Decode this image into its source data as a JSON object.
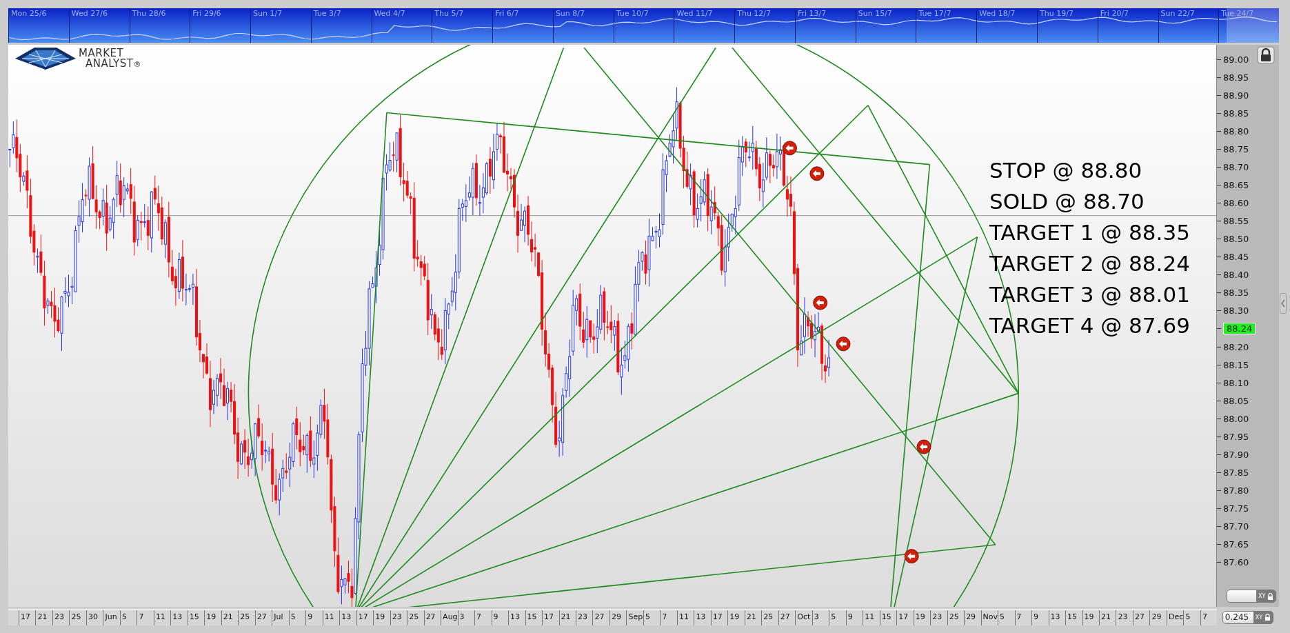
{
  "overview": {
    "labels": [
      "Mon 25/6",
      "Wed 27/6",
      "Thu 28/6",
      "Fri 29/6",
      "Sun 1/7",
      "Tue 3/7",
      "Wed 4/7",
      "Thu 5/7",
      "Fri 6/7",
      "Sun 8/7",
      "Tue 10/7",
      "Wed 11/7",
      "Thu 12/7",
      "Fri 13/7",
      "Sun 15/7",
      "Tue 17/7",
      "Wed 18/7",
      "Thu 19/7",
      "Fri 20/7",
      "Sun 22/7",
      "Tue 24/7"
    ]
  },
  "chart": {
    "logo": {
      "line1": "MARKET",
      "line2": "ANALYST",
      "mark": "®"
    },
    "notes": [
      "STOP @ 88.80",
      "SOLD @ 88.70",
      "TARGET 1 @ 88.35",
      "TARGET 2 @ 88.24",
      "TARGET 3 @ 88.01",
      "TARGET 4 @ 87.69"
    ],
    "price_axis": [
      {
        "text": "89.00",
        "kind": "tick"
      },
      {
        "text": "88.95",
        "kind": "tick"
      },
      {
        "text": "88.90",
        "kind": "tick"
      },
      {
        "text": "88.85",
        "kind": "tick"
      },
      {
        "text": "88.80",
        "kind": "tick"
      },
      {
        "text": "88.75",
        "kind": "tick"
      },
      {
        "text": "88.70",
        "kind": "tick"
      },
      {
        "text": "88.65",
        "kind": "tick"
      },
      {
        "text": "88.60",
        "kind": "tick"
      },
      {
        "text": "88.55",
        "kind": "tick"
      },
      {
        "text": "88.50",
        "kind": "tick"
      },
      {
        "text": "88.45",
        "kind": "tick"
      },
      {
        "text": "88.40",
        "kind": "tick"
      },
      {
        "text": "88.35",
        "kind": "tick"
      },
      {
        "text": "88.30",
        "kind": "tick"
      },
      {
        "text": "88.24",
        "kind": "current"
      },
      {
        "text": "88.20",
        "kind": "tick"
      },
      {
        "text": "88.15",
        "kind": "tick"
      },
      {
        "text": "88.10",
        "kind": "tick"
      },
      {
        "text": "88.05",
        "kind": "tick"
      },
      {
        "text": "88.00",
        "kind": "tick"
      },
      {
        "text": "87.95",
        "kind": "tick"
      },
      {
        "text": "87.90",
        "kind": "tick"
      },
      {
        "text": "87.85",
        "kind": "tick"
      },
      {
        "text": "87.80",
        "kind": "tick"
      },
      {
        "text": "87.75",
        "kind": "tick"
      },
      {
        "text": "87.70",
        "kind": "tick"
      },
      {
        "text": "87.65",
        "kind": "tick"
      },
      {
        "text": "87.60",
        "kind": "tick"
      }
    ]
  },
  "date_axis": [
    "17",
    "21",
    "23",
    "25",
    "30",
    "Jun",
    "5",
    "7",
    "11",
    "13",
    "15",
    "19",
    "21",
    "25",
    "27",
    "Jul",
    "5",
    "9",
    "11",
    "13",
    "17",
    "19",
    "23",
    "25",
    "27",
    "Aug",
    "3",
    "7",
    "9",
    "13",
    "15",
    "17",
    "21",
    "23",
    "27",
    "29",
    "Sep",
    "5",
    "7",
    "11",
    "13",
    "17",
    "19",
    "21",
    "25",
    "27",
    "Oct",
    "3",
    "5",
    "9",
    "11",
    "15",
    "17",
    "19",
    "23",
    "25",
    "29",
    "Nov",
    "5",
    "7",
    "9",
    "13",
    "15",
    "19",
    "21",
    "23",
    "27",
    "29",
    "Dec",
    "5",
    "7"
  ],
  "controls": [
    {
      "kind": "slider",
      "tag": "XY",
      "level": 1
    },
    {
      "kind": "field",
      "value": "0.245",
      "tag": "XY"
    }
  ]
}
